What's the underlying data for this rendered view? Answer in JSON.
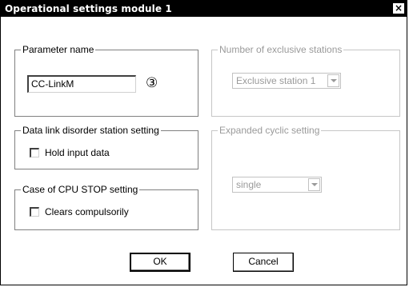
{
  "window": {
    "title": "Operational settings  module 1",
    "close_glyph": "×"
  },
  "parameter_name": {
    "legend": "Parameter name",
    "value": "CC-LinkM",
    "marker": "③"
  },
  "data_link": {
    "legend": "Data link disorder station setting",
    "checkbox_label": "Hold input data",
    "checked": false
  },
  "cpu_stop": {
    "legend": "Case of CPU STOP setting",
    "checkbox_label": "Clears compulsorily",
    "checked": false
  },
  "exclusive_stations": {
    "legend": "Number of exclusive stations",
    "selected": "Exclusive station 1",
    "enabled": false
  },
  "expanded_cyclic": {
    "legend": "Expanded cyclic setting",
    "selected": "single",
    "enabled": false
  },
  "buttons": {
    "ok": "OK",
    "cancel": "Cancel"
  }
}
